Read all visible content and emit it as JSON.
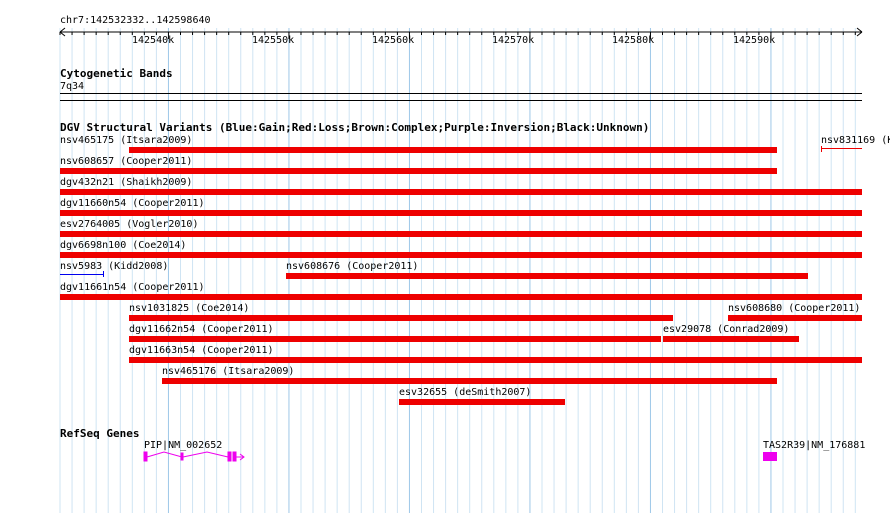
{
  "ruler": {
    "location": "chr7:142532332..142598640",
    "ticks": [
      "142540k",
      "142550k",
      "142560k",
      "142570k",
      "142580k",
      "142590k"
    ]
  },
  "cytoband": {
    "title": "Cytogenetic Bands",
    "band": "7q34"
  },
  "dgv": {
    "title": "DGV Structural Variants (Blue:Gain;Red:Loss;Brown:Complex;Purple:Inversion;Black:Unknown)",
    "colors": {
      "loss": "#ee0000",
      "gain": "#0000ee"
    },
    "variants": [
      {
        "label": "nsv465175 (Itsara2009)",
        "type": "loss"
      },
      {
        "label": "nsv831169 (K",
        "type": "loss"
      },
      {
        "label": "nsv608657 (Cooper2011)",
        "type": "loss"
      },
      {
        "label": "dgv432n21 (Shaikh2009)",
        "type": "loss"
      },
      {
        "label": "dgv11660n54 (Cooper2011)",
        "type": "loss"
      },
      {
        "label": "esv2764005 (Vogler2010)",
        "type": "loss"
      },
      {
        "label": "dgv6698n100 (Coe2014)",
        "type": "loss"
      },
      {
        "label": "nsv5983 (Kidd2008)",
        "type": "gain"
      },
      {
        "label": "nsv608676 (Cooper2011)",
        "type": "loss"
      },
      {
        "label": "dgv11661n54 (Cooper2011)",
        "type": "loss"
      },
      {
        "label": "nsv1031825 (Coe2014)",
        "type": "loss"
      },
      {
        "label": "nsv608680 (Cooper2011)",
        "type": "loss"
      },
      {
        "label": "dgv11662n54 (Cooper2011)",
        "type": "loss"
      },
      {
        "label": "esv29078 (Conrad2009)",
        "type": "loss"
      },
      {
        "label": "dgv11663n54 (Cooper2011)",
        "type": "loss"
      },
      {
        "label": "nsv465176 (Itsara2009)",
        "type": "loss"
      },
      {
        "label": "esv32655 (deSmith2007)",
        "type": "loss"
      }
    ]
  },
  "refseq": {
    "title": "RefSeq Genes",
    "color": "#ee00ee",
    "genes": [
      {
        "label": "PIP|NM_002652"
      },
      {
        "label": "TAS2R39|NM_176881"
      }
    ]
  }
}
